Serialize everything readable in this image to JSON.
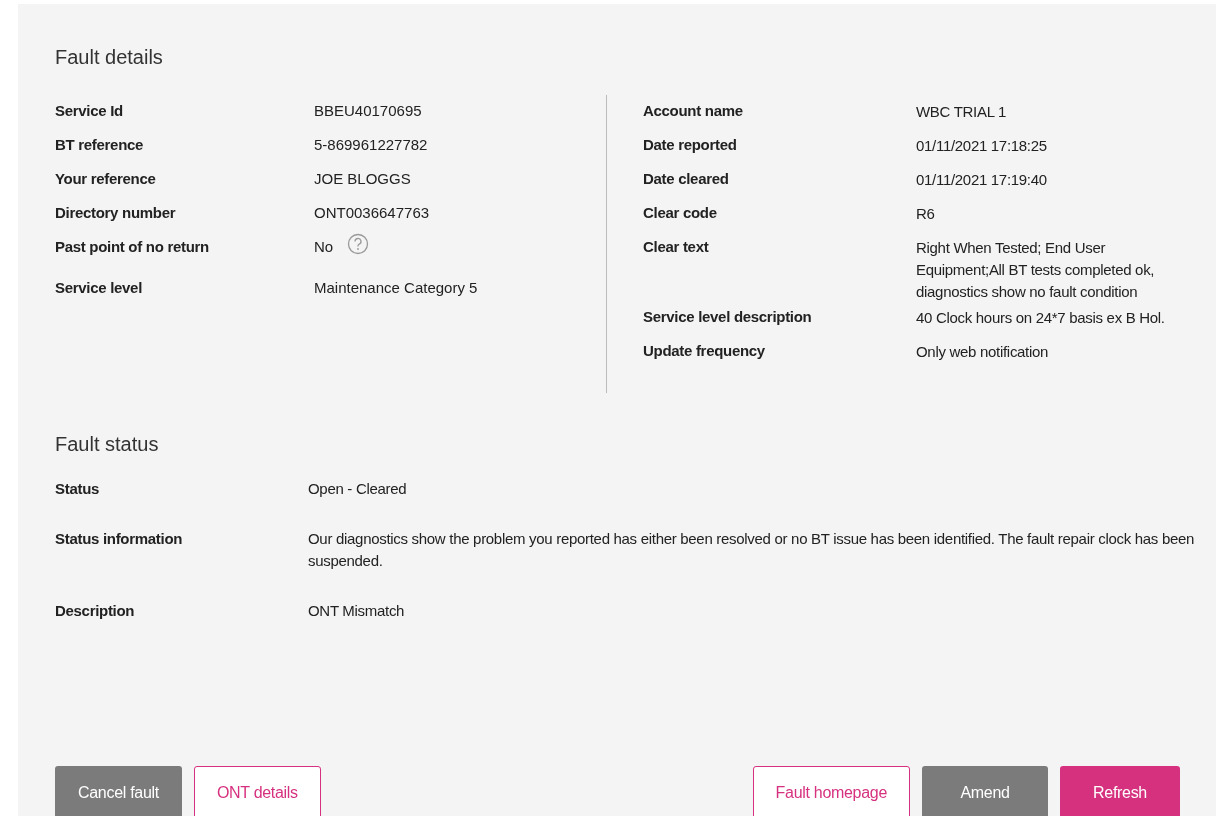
{
  "fault_details": {
    "title": "Fault details",
    "left_fields": [
      {
        "label": "Service Id",
        "value": "BBEU40170695"
      },
      {
        "label": "BT reference",
        "value": "5-869961227782"
      },
      {
        "label": "Your reference",
        "value": "JOE BLOGGS"
      },
      {
        "label": "Directory number",
        "value": "ONT0036647763"
      },
      {
        "label": "Past point of no return",
        "value": "No",
        "help": true
      },
      {
        "label": "Service level",
        "value": "Maintenance Category 5"
      }
    ],
    "right_fields": [
      {
        "label": "Account name",
        "value": "WBC TRIAL 1"
      },
      {
        "label": "Date reported",
        "value": "01/11/2021 17:18:25"
      },
      {
        "label": "Date cleared",
        "value": "01/11/2021 17:19:40"
      },
      {
        "label": "Clear code",
        "value": "R6"
      },
      {
        "label": "Clear text",
        "value": "Right When Tested; End User Equipment;All BT tests completed ok, diagnostics show no fault condition"
      },
      {
        "label": "Service level description",
        "value": "40 Clock hours on 24*7 basis ex B Hol."
      },
      {
        "label": "Update frequency",
        "value": "Only web notification"
      }
    ]
  },
  "fault_status": {
    "title": "Fault status",
    "fields": [
      {
        "label": "Status",
        "value": "Open - Cleared"
      },
      {
        "label": "Status information",
        "value": "Our diagnostics show the problem you reported has either been resolved or no BT issue has been identified. The fault repair clock has been suspended."
      },
      {
        "label": "Description",
        "value": "ONT Mismatch"
      }
    ]
  },
  "buttons_left": [
    {
      "label": "Cancel fault",
      "kind": "grey"
    },
    {
      "label": "ONT details",
      "kind": "outline"
    }
  ],
  "buttons_right": [
    {
      "label": "Fault homepage",
      "kind": "outline"
    },
    {
      "label": "Amend",
      "kind": "grey"
    },
    {
      "label": "Refresh",
      "kind": "primary"
    }
  ]
}
